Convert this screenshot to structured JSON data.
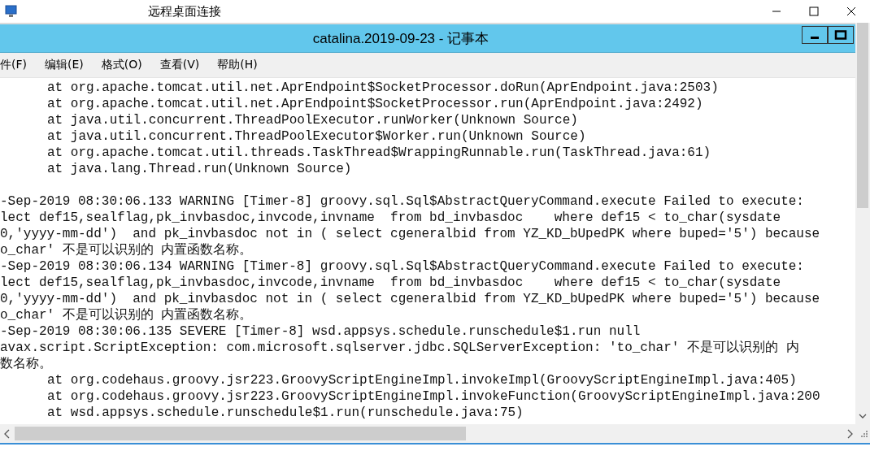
{
  "window": {
    "title": "远程桌面连接"
  },
  "notepad": {
    "title": "catalina.2019-09-23 - 记事本"
  },
  "menu": [
    "件(F)",
    "编辑(E)",
    "格式(O)",
    "查看(V)",
    "帮助(H)"
  ],
  "lines": [
    {
      "kind": "frame",
      "text": "at org.apache.tomcat.util.net.AprEndpoint$SocketProcessor.doRun(AprEndpoint.java:2503)"
    },
    {
      "kind": "frame",
      "text": "at org.apache.tomcat.util.net.AprEndpoint$SocketProcessor.run(AprEndpoint.java:2492)"
    },
    {
      "kind": "frame",
      "text": "at java.util.concurrent.ThreadPoolExecutor.runWorker(Unknown Source)"
    },
    {
      "kind": "frame",
      "text": "at java.util.concurrent.ThreadPoolExecutor$Worker.run(Unknown Source)"
    },
    {
      "kind": "frame",
      "text": "at org.apache.tomcat.util.threads.TaskThread$WrappingRunnable.run(TaskThread.java:61)"
    },
    {
      "kind": "frame",
      "text": "at java.lang.Thread.run(Unknown Source)"
    },
    {
      "kind": "blank"
    },
    {
      "kind": "plain",
      "text": "-Sep-2019 08:30:06.133 WARNING [Timer-8] groovy.sql.Sql$AbstractQueryCommand.execute Failed to execute:"
    },
    {
      "kind": "plain",
      "text": "lect def15,sealflag,pk_invbasdoc,invcode,invname  from bd_invbasdoc    where def15 < to_char(sysdate"
    },
    {
      "kind": "plain",
      "text": "0,'yyyy-mm-dd')  and pk_invbasdoc not in ( select cgeneralbid from YZ_KD_bUpedPK where buped='5') because"
    },
    {
      "kind": "plain",
      "text": "o_char' 不是可以识别的 内置函数名称。"
    },
    {
      "kind": "plain",
      "text": "-Sep-2019 08:30:06.134 WARNING [Timer-8] groovy.sql.Sql$AbstractQueryCommand.execute Failed to execute:"
    },
    {
      "kind": "plain",
      "text": "lect def15,sealflag,pk_invbasdoc,invcode,invname  from bd_invbasdoc    where def15 < to_char(sysdate"
    },
    {
      "kind": "plain",
      "text": "0,'yyyy-mm-dd')  and pk_invbasdoc not in ( select cgeneralbid from YZ_KD_bUpedPK where buped='5') because"
    },
    {
      "kind": "plain",
      "text": "o_char' 不是可以识别的 内置函数名称。"
    },
    {
      "kind": "plain",
      "text": "-Sep-2019 08:30:06.135 SEVERE [Timer-8] wsd.appsys.schedule.runschedule$1.run null"
    },
    {
      "kind": "plain",
      "text": "avax.script.ScriptException: com.microsoft.sqlserver.jdbc.SQLServerException: 'to_char' 不是可以识别的 内"
    },
    {
      "kind": "plain",
      "text": "数名称。"
    },
    {
      "kind": "frame",
      "text": "at org.codehaus.groovy.jsr223.GroovyScriptEngineImpl.invokeImpl(GroovyScriptEngineImpl.java:405)"
    },
    {
      "kind": "frame",
      "text": "at org.codehaus.groovy.jsr223.GroovyScriptEngineImpl.invokeFunction(GroovyScriptEngineImpl.java:200"
    },
    {
      "kind": "frame",
      "text": "at wsd.appsys.schedule.runschedule$1.run(runschedule.java:75)"
    }
  ]
}
